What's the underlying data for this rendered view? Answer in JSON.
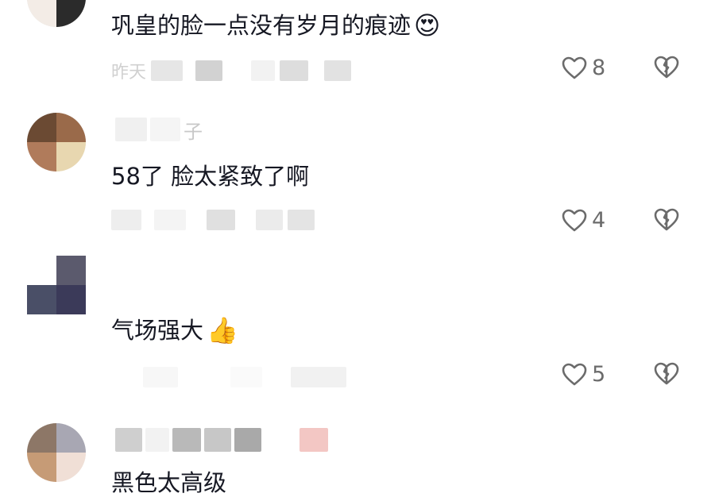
{
  "comments": [
    {
      "text": "巩皇的脸一点没有岁月的痕迹",
      "emoji": "😍",
      "meta_text": "昨天",
      "like_count": "8"
    },
    {
      "username_fragment": "子",
      "text": "58了 脸太紧致了啊",
      "emoji": "",
      "like_count": "4"
    },
    {
      "text": "气场强大",
      "emoji": "👍",
      "like_count": "5"
    },
    {
      "text": "黑色太高级",
      "emoji": ""
    }
  ],
  "colors": {
    "text": "#161823",
    "meta": "#c4c4c4",
    "icon": "#6b6b6b"
  }
}
